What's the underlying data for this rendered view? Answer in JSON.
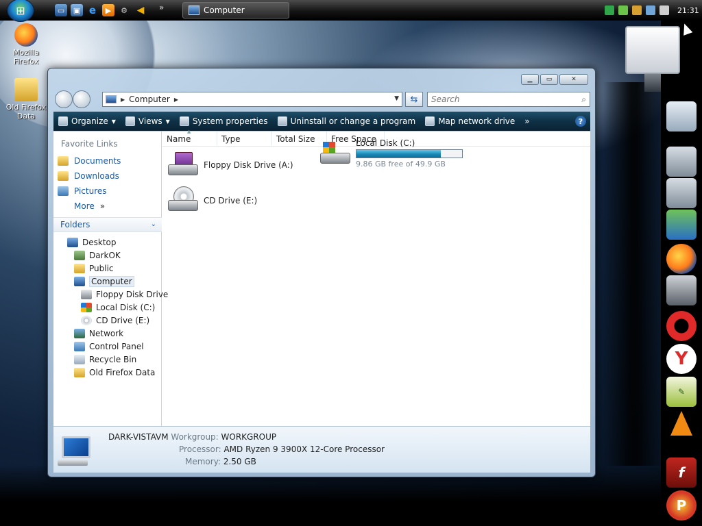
{
  "taskbar": {
    "active_window": "Computer",
    "clock": "21:31",
    "more_chevron": "»"
  },
  "desktop_icons": [
    {
      "label_line1": "Mozilla",
      "label_line2": "Firefox"
    },
    {
      "label_line1": "Old Firefox",
      "label_line2": "Data"
    }
  ],
  "window": {
    "address_path": "Computer",
    "search_placeholder": "Search",
    "toolbar": {
      "organize": "Organize",
      "views": "Views",
      "system_properties": "System properties",
      "uninstall": "Uninstall or change a program",
      "map_drive": "Map network drive",
      "more": "»",
      "help": "?"
    }
  },
  "nav_pane": {
    "favorite_links_title": "Favorite Links",
    "favorites": [
      "Documents",
      "Downloads",
      "Pictures",
      "More"
    ],
    "more_chevron": "»",
    "folders_title": "Folders",
    "tree": [
      {
        "label": "Desktop",
        "indent": 1
      },
      {
        "label": "DarkOK",
        "indent": 2
      },
      {
        "label": "Public",
        "indent": 2
      },
      {
        "label": "Computer",
        "indent": 2,
        "selected": true
      },
      {
        "label": "Floppy Disk Drive",
        "indent": 3
      },
      {
        "label": "Local Disk (C:)",
        "indent": 3
      },
      {
        "label": "CD Drive (E:)",
        "indent": 3
      },
      {
        "label": "Network",
        "indent": 2
      },
      {
        "label": "Control Panel",
        "indent": 2
      },
      {
        "label": "Recycle Bin",
        "indent": 2
      },
      {
        "label": "Old Firefox Data",
        "indent": 2
      }
    ]
  },
  "columns": [
    "Name",
    "Type",
    "Total Size",
    "Free Space"
  ],
  "items": {
    "floppy": "Floppy Disk Drive (A:)",
    "cd": "CD Drive (E:)",
    "local_disk": {
      "label": "Local Disk (C:)",
      "free_text": "9.86 GB free of 49.9 GB",
      "used_fraction": 0.8
    }
  },
  "details": {
    "computer_name": "DARK-VISTAVM",
    "workgroup_key": "Workgroup:",
    "workgroup_val": "WORKGROUP",
    "processor_key": "Processor:",
    "processor_val": "AMD Ryzen 9 3900X 12-Core Processor",
    "memory_key": "Memory:",
    "memory_val": "2.50 GB"
  },
  "colors": {
    "link_blue": "#1a5aa6",
    "toolbar_teal": "#0e3146",
    "progress_blue": "#1a88b6"
  }
}
